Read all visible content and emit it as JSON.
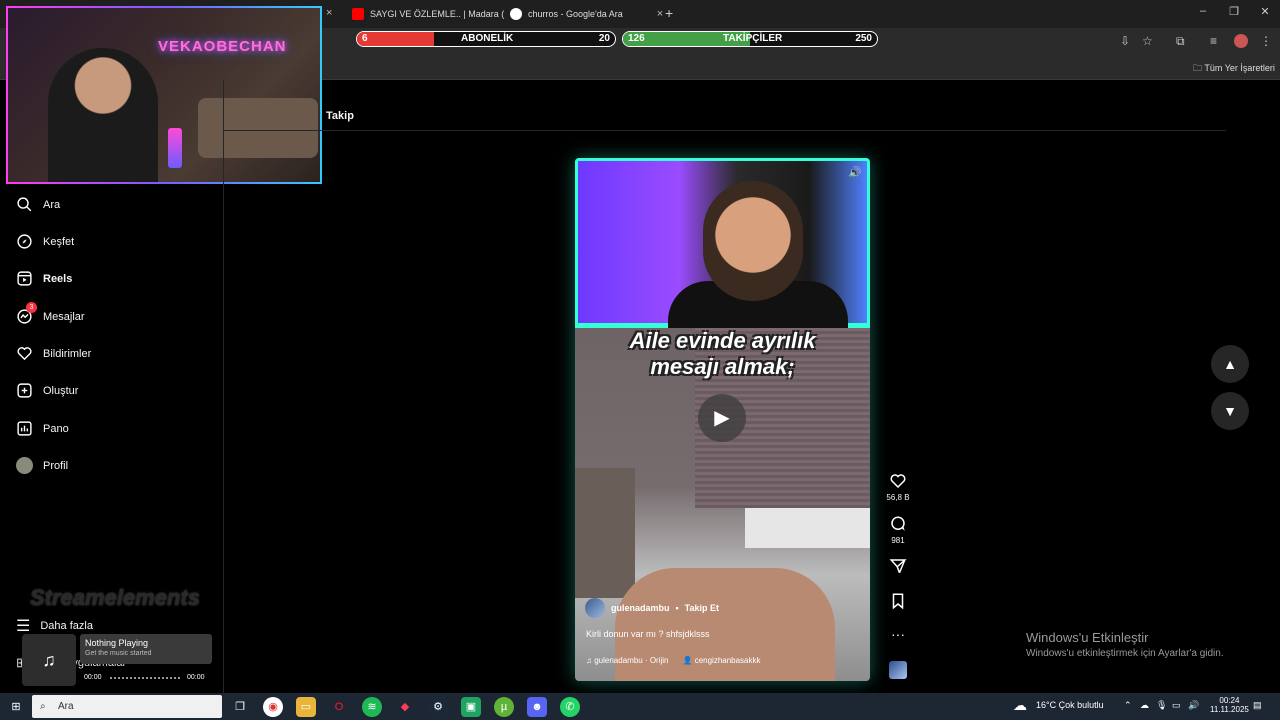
{
  "browser": {
    "tabs": [
      {
        "label": "SAYGI VE ÖZLEMLE.. | Madara (",
        "favicon_color": "#ff0000"
      },
      {
        "label": "churros - Google'da Ara",
        "favicon_color": "#ffffff"
      }
    ],
    "new_tab": "+",
    "bookmarks_all": "Tüm Yer İşaretleri"
  },
  "overlay": {
    "subscriber": {
      "label": "ABONELİK",
      "current": "6",
      "goal": "20",
      "fill": 0.3,
      "color": "#e53935"
    },
    "followers": {
      "label": "TAKİPÇİLER",
      "current": "126",
      "goal": "250",
      "fill": 0.5,
      "color": "#43a047"
    }
  },
  "webcam": {
    "sign": "VEKAOBECHAN"
  },
  "sidebar": {
    "items": [
      {
        "label": "Ara",
        "icon": "search-icon"
      },
      {
        "label": "Keşfet",
        "icon": "compass-icon"
      },
      {
        "label": "Reels",
        "icon": "reels-icon"
      },
      {
        "label": "Mesajlar",
        "icon": "messenger-icon",
        "badge": "3"
      },
      {
        "label": "Bildirimler",
        "icon": "heart-icon"
      },
      {
        "label": "Oluştur",
        "icon": "plus-square-icon"
      },
      {
        "label": "Pano",
        "icon": "chart-icon"
      },
      {
        "label": "Profil",
        "icon": "avatar"
      }
    ],
    "more": "Daha fazla",
    "other_apps": "Diğer uygulamalar"
  },
  "header": {
    "tab": "Takip"
  },
  "reel": {
    "caption_line1": "Aile evinde ayrılık",
    "caption_line2": "mesajı almak;",
    "username": "gulenadambu",
    "follow": "Takip Et",
    "description": "Kirli donun var mı ? shfsjdklsss",
    "audio": "gulenadambu · Orijin",
    "tagged": "cengizhanbasakkk"
  },
  "actions": {
    "likes": "56,8 B",
    "comments": "981"
  },
  "windows_activate": {
    "title": "Windows'u Etkinleştir",
    "subtitle": "Windows'u etkinleştirmek için Ayarlar'a gidin."
  },
  "music": {
    "title": "Nothing Playing",
    "subtitle": "Get the music started",
    "time_start": "00:00",
    "time_end": "00:00"
  },
  "watermark": "Streamelements",
  "taskbar": {
    "search": "Ara",
    "weather": "16°C  Çok bulutlu",
    "time": "00:24",
    "date": "11.11.2025"
  }
}
